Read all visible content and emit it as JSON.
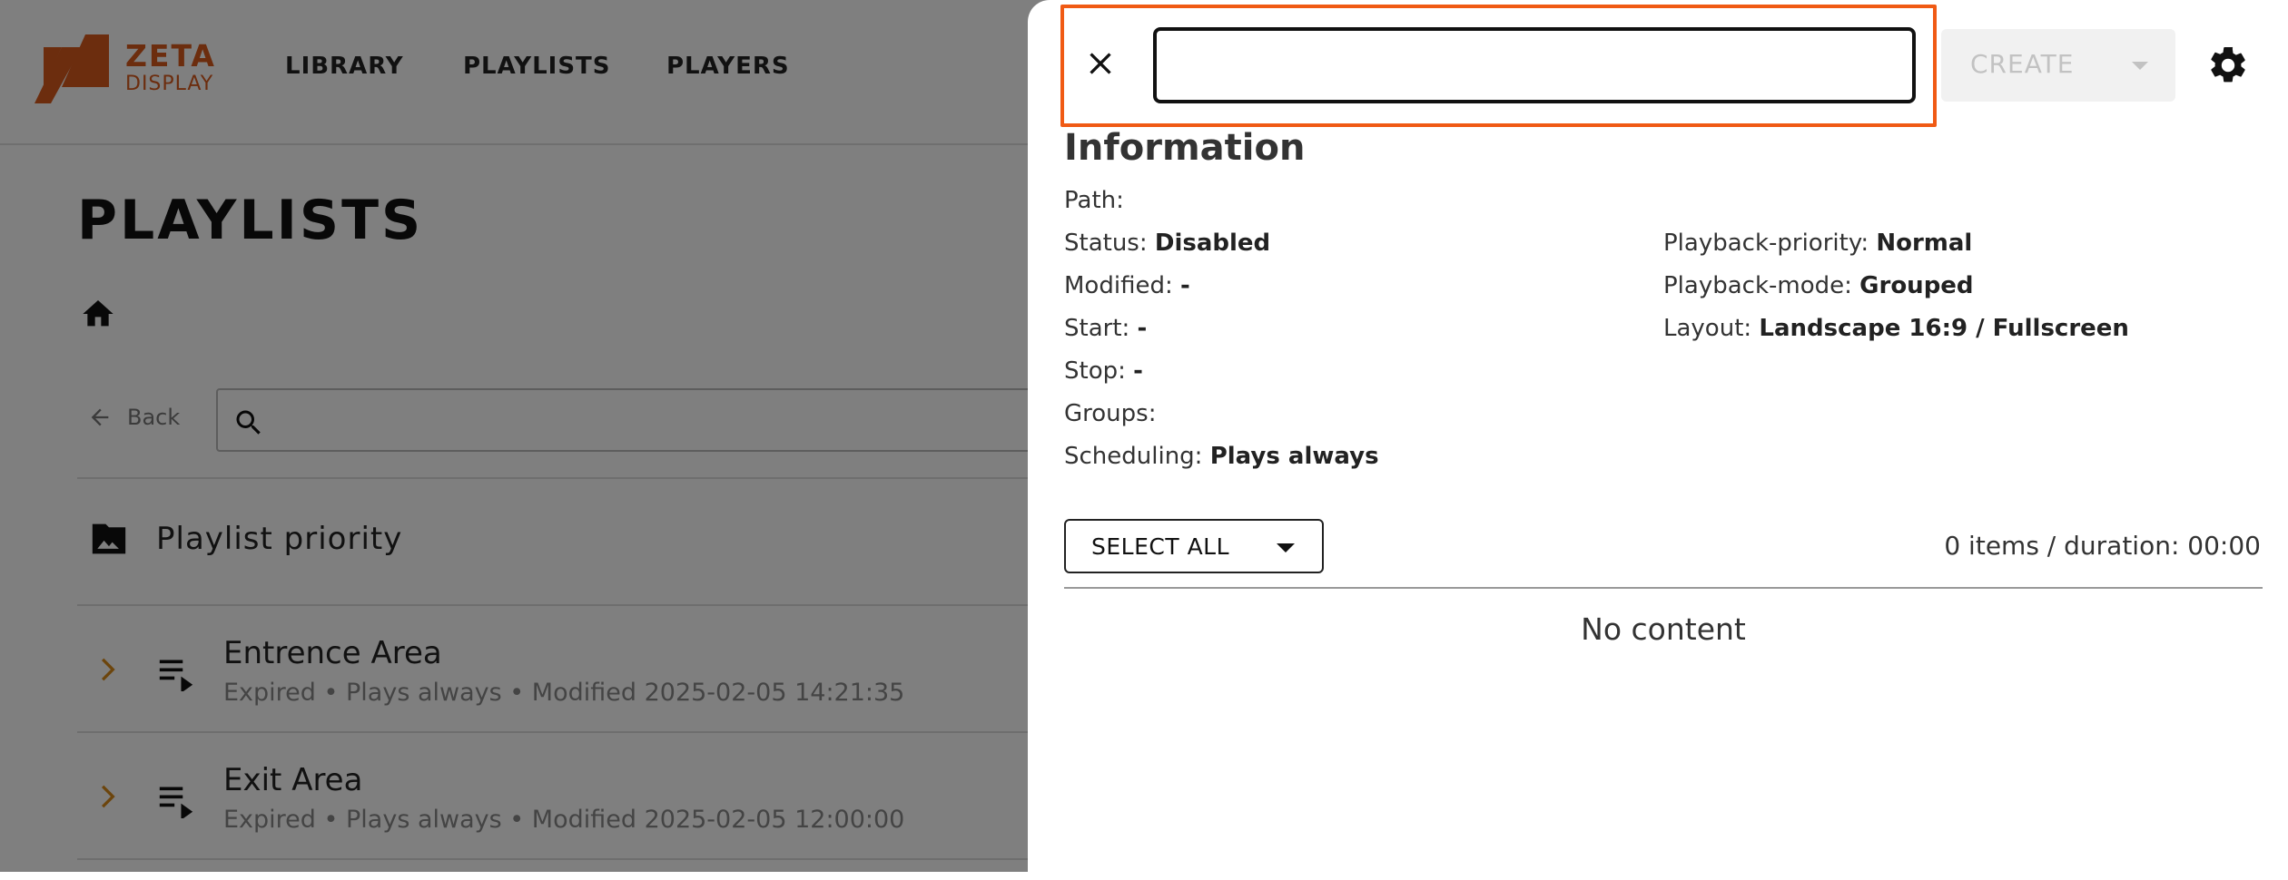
{
  "brand": {
    "name_top": "ZETA",
    "name_bottom": "DISPLAY",
    "color": "#d85a1c"
  },
  "nav": {
    "library": "LIBRARY",
    "playlists": "PLAYLISTS",
    "players": "PLAYERS"
  },
  "page": {
    "title": "PLAYLISTS",
    "back_label": "Back",
    "folder_label": "Playlist priority",
    "playlists": [
      {
        "title": "Entrence Area",
        "meta": "Expired  •  Plays always  •  Modified 2025-02-05 14:21:35"
      },
      {
        "title": "Exit Area",
        "meta": "Expired  •  Plays always  •  Modified 2025-02-05 12:00:00"
      }
    ]
  },
  "drawer": {
    "name_input": {
      "value": "",
      "placeholder": ""
    },
    "create_label": "CREATE",
    "info_title": "Information",
    "fields": {
      "path": {
        "label": "Path:",
        "value": ""
      },
      "status": {
        "label": "Status:",
        "value": "Disabled"
      },
      "modified": {
        "label": "Modified:",
        "value": "-"
      },
      "start": {
        "label": "Start:",
        "value": "-"
      },
      "stop": {
        "label": "Stop:",
        "value": "-"
      },
      "groups": {
        "label": "Groups:",
        "value": ""
      },
      "scheduling": {
        "label": "Scheduling:",
        "value": "Plays always"
      },
      "playback_priority": {
        "label": "Playback-priority:",
        "value": "Normal"
      },
      "playback_mode": {
        "label": "Playback-mode:",
        "value": "Grouped"
      },
      "layout": {
        "label": "Layout:",
        "value": "Landscape 16:9 / Fullscreen"
      }
    },
    "select_all_label": "SELECT ALL",
    "items_summary": "0 items /  duration: 00:00",
    "no_content": "No content"
  },
  "colors": {
    "accent_highlight": "#f05a14",
    "chevron": "#d98a1a",
    "overlay": "rgba(0,0,0,0.5)"
  }
}
